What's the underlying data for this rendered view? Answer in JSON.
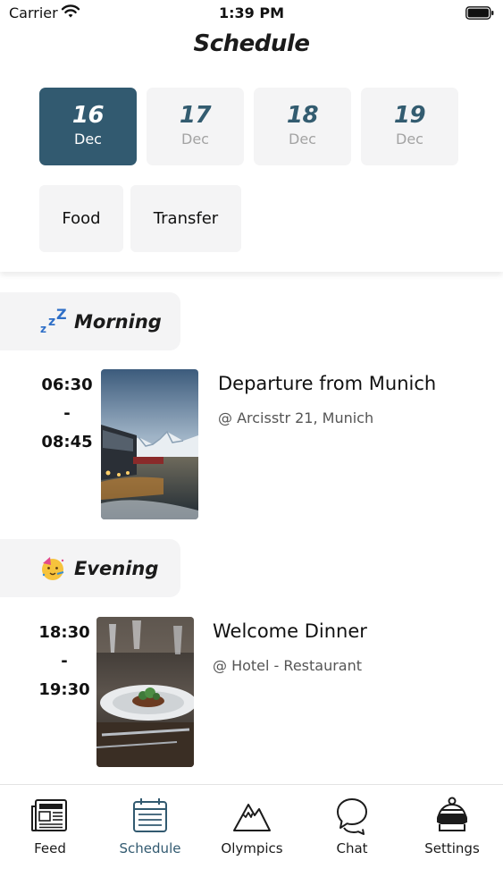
{
  "status_bar": {
    "carrier": "Carrier",
    "time": "1:39 PM"
  },
  "header": {
    "title": "Schedule"
  },
  "dates": [
    {
      "day": "16",
      "month": "Dec",
      "selected": true
    },
    {
      "day": "17",
      "month": "Dec",
      "selected": false
    },
    {
      "day": "18",
      "month": "Dec",
      "selected": false
    },
    {
      "day": "19",
      "month": "Dec",
      "selected": false
    }
  ],
  "filters": [
    {
      "label": "Food"
    },
    {
      "label": "Transfer"
    }
  ],
  "sections": [
    {
      "title": "Morning",
      "icon": "sleeping-zzz-icon",
      "event": {
        "start": "06:30",
        "separator": "-",
        "end": "08:45",
        "title": "Departure from Munich",
        "location": "@ Arcisstr 21, Munich"
      }
    },
    {
      "title": "Evening",
      "icon": "party-face-icon",
      "event": {
        "start": "18:30",
        "separator": "-",
        "end": "19:30",
        "title": "Welcome Dinner",
        "location": "@ Hotel - Restaurant"
      }
    }
  ],
  "tabs": [
    {
      "label": "Feed",
      "icon": "newspaper-icon",
      "active": false
    },
    {
      "label": "Schedule",
      "icon": "calendar-icon",
      "active": true
    },
    {
      "label": "Olympics",
      "icon": "mountain-icon",
      "active": false
    },
    {
      "label": "Chat",
      "icon": "chat-bubbles-icon",
      "active": false
    },
    {
      "label": "Settings",
      "icon": "ski-helmet-icon",
      "active": false
    }
  ],
  "colors": {
    "accent": "#325a70",
    "chip_bg": "#f4f4f5",
    "muted_text": "#a3a3a3"
  }
}
